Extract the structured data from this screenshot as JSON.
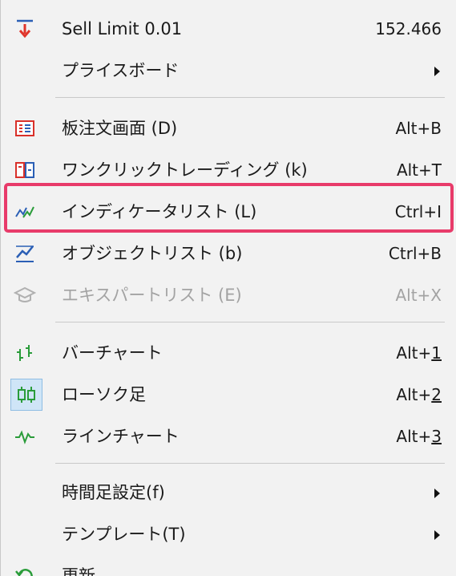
{
  "menu": {
    "items": [
      {
        "label": "Sell Limit 0.01",
        "shortcut": "152.466",
        "icon": "sell-limit-arrow-icon"
      },
      {
        "label": "プライスボード",
        "submenu": true
      },
      {
        "label": "板注文画面 (D)",
        "shortcut": "Alt+B",
        "icon": "order-board-icon"
      },
      {
        "label": "ワンクリックトレーディング (k)",
        "shortcut": "Alt+T",
        "icon": "one-click-trading-icon"
      },
      {
        "label": "インディケータリスト (L)",
        "shortcut": "Ctrl+I",
        "icon": "indicator-icon"
      },
      {
        "label": "オブジェクトリスト (b)",
        "shortcut": "Ctrl+B",
        "icon": "object-list-icon"
      },
      {
        "label": "エキスパートリスト (E)",
        "shortcut": "Alt+X",
        "icon": "expert-cap-icon",
        "disabled": true
      },
      {
        "label": "バーチャート",
        "shortcut_prefix": "Alt+",
        "shortcut_key": "1",
        "icon": "bar-chart-icon"
      },
      {
        "label": "ローソク足",
        "shortcut_prefix": "Alt+",
        "shortcut_key": "2",
        "icon": "candlestick-icon",
        "checked": true
      },
      {
        "label": "ラインチャート",
        "shortcut_prefix": "Alt+",
        "shortcut_key": "3",
        "icon": "line-chart-icon"
      },
      {
        "label": "時間足設定(f)",
        "submenu": true
      },
      {
        "label": "テンプレート(T)",
        "submenu": true
      },
      {
        "label": "更新",
        "icon": "refresh-icon"
      }
    ],
    "highlight_color": "#e83b6a"
  }
}
